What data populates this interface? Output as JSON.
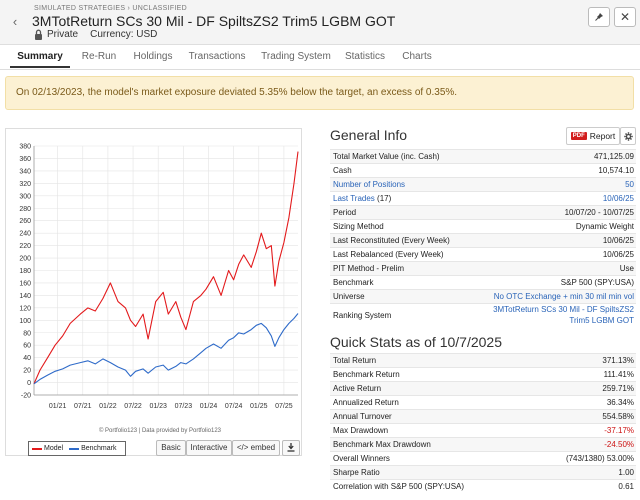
{
  "header": {
    "breadcrumb": "SIMULATED STRATEGIES › UNCLASSIFIED",
    "title": "3MTotReturn SCs 30 Mil - DF SpiltsZS2 Trim5 LGBM GOT",
    "privacy": "Private",
    "currency_label": "Currency: USD",
    "icons": {
      "back": "chevron-left-icon",
      "lock": "lock-icon",
      "pin": "pin-icon",
      "close": "close-icon"
    }
  },
  "tabs": [
    {
      "label": "Summary",
      "active": true
    },
    {
      "label": "Re-Run",
      "active": false
    },
    {
      "label": "Holdings",
      "active": false
    },
    {
      "label": "Transactions",
      "active": false
    },
    {
      "label": "Trading System",
      "active": false
    },
    {
      "label": "Statistics",
      "active": false
    },
    {
      "label": "Charts",
      "active": false
    }
  ],
  "alert": {
    "text": "On 02/13/2023, the model's market exposure deviated 5.35% below the target, an excess of 0.35%."
  },
  "chart": {
    "credit": "© Portfolio123 | Data provided by Portfolio123",
    "legend": {
      "model": "Model",
      "benchmark": "Benchmark"
    },
    "buttons": {
      "basic": "Basic",
      "interactive": "Interactive",
      "embed": "</> embed"
    },
    "colors": {
      "model": "#e31a1c",
      "benchmark": "#2f6bc9"
    }
  },
  "chart_data": {
    "type": "line",
    "title": "",
    "xlabel": "",
    "ylabel": "",
    "ylim": [
      -20,
      380
    ],
    "yticks": [
      -20,
      0,
      20,
      40,
      60,
      80,
      100,
      120,
      140,
      160,
      180,
      200,
      220,
      240,
      260,
      280,
      300,
      320,
      340,
      360,
      380
    ],
    "xlim": [
      2020.53,
      2025.78
    ],
    "x_tick_labels": [
      "01/21",
      "07/21",
      "01/22",
      "07/22",
      "01/23",
      "07/23",
      "01/24",
      "07/24",
      "01/25",
      "07/25"
    ],
    "x_tick_positions": [
      2021.0,
      2021.5,
      2022.0,
      2022.5,
      2023.0,
      2023.5,
      2024.0,
      2024.5,
      2025.0,
      2025.5
    ],
    "grid": true,
    "legend_position": "bottom-left",
    "series": [
      {
        "name": "Model",
        "x": [
          2020.53,
          2020.65,
          2020.8,
          2020.95,
          2021.1,
          2021.25,
          2021.45,
          2021.6,
          2021.75,
          2021.9,
          2022.05,
          2022.2,
          2022.35,
          2022.45,
          2022.55,
          2022.7,
          2022.8,
          2022.95,
          2023.1,
          2023.2,
          2023.35,
          2023.45,
          2023.55,
          2023.7,
          2023.85,
          2023.95,
          2024.1,
          2024.25,
          2024.4,
          2024.5,
          2024.6,
          2024.7,
          2024.85,
          2024.95,
          2025.05,
          2025.15,
          2025.25,
          2025.32,
          2025.4,
          2025.5,
          2025.6,
          2025.7,
          2025.78
        ],
        "y": [
          -2,
          20,
          40,
          60,
          75,
          95,
          110,
          120,
          115,
          135,
          160,
          130,
          120,
          100,
          90,
          110,
          70,
          130,
          145,
          110,
          130,
          105,
          85,
          130,
          140,
          150,
          170,
          140,
          180,
          165,
          190,
          205,
          185,
          210,
          240,
          215,
          220,
          155,
          195,
          225,
          265,
          320,
          371
        ]
      },
      {
        "name": "Benchmark",
        "x": [
          2020.53,
          2020.65,
          2020.8,
          2020.95,
          2021.1,
          2021.25,
          2021.45,
          2021.6,
          2021.75,
          2021.9,
          2022.05,
          2022.2,
          2022.35,
          2022.45,
          2022.55,
          2022.7,
          2022.8,
          2022.95,
          2023.1,
          2023.2,
          2023.35,
          2023.45,
          2023.55,
          2023.7,
          2023.85,
          2023.95,
          2024.1,
          2024.25,
          2024.4,
          2024.5,
          2024.6,
          2024.7,
          2024.85,
          2024.95,
          2025.05,
          2025.15,
          2025.25,
          2025.32,
          2025.4,
          2025.5,
          2025.6,
          2025.7,
          2025.78
        ],
        "y": [
          -2,
          5,
          12,
          18,
          22,
          28,
          32,
          35,
          30,
          38,
          32,
          25,
          20,
          10,
          18,
          22,
          15,
          25,
          28,
          20,
          26,
          32,
          30,
          38,
          48,
          55,
          62,
          55,
          68,
          72,
          80,
          78,
          85,
          92,
          95,
          88,
          75,
          58,
          72,
          85,
          95,
          103,
          111
        ]
      }
    ]
  },
  "general_info": {
    "title": "General Info",
    "report_label": "Report",
    "pdf_label": "PDF",
    "rows": [
      {
        "label": "Total Market Value (inc. Cash)",
        "value": "471,125.09"
      },
      {
        "label": "Cash",
        "value": "10,574.10"
      },
      {
        "label": "Number of Positions",
        "value": "50",
        "link": true
      },
      {
        "label": "Last Trades",
        "count": "(17)",
        "value": "10/06/25",
        "link": true
      },
      {
        "label": "Period",
        "value": "10/07/20 - 10/07/25"
      },
      {
        "label": "Sizing Method",
        "value": "Dynamic Weight"
      },
      {
        "label": "Last Reconstituted (Every Week)",
        "value": "10/06/25"
      },
      {
        "label": "Last Rebalanced (Every Week)",
        "value": "10/06/25"
      },
      {
        "label": "PIT Method - Prelim",
        "value": "Use"
      },
      {
        "label": "Benchmark",
        "value": "S&P 500 (SPY:USA)"
      },
      {
        "label": "Universe",
        "value": "No OTC Exchange + min 30 mil min vol",
        "value_link": true
      },
      {
        "label": "Ranking System",
        "value": "3MTotReturn SCs 30 Mil - DF SpiltsZS2 Trim5 LGBM GOT",
        "value_link": true
      }
    ]
  },
  "quick_stats": {
    "title": "Quick Stats as of 10/7/2025",
    "rows": [
      {
        "label": "Total Return",
        "value": "371.13%"
      },
      {
        "label": "Benchmark Return",
        "value": "111.41%"
      },
      {
        "label": "Active Return",
        "value": "259.71%"
      },
      {
        "label": "Annualized Return",
        "value": "36.34%"
      },
      {
        "label": "Annual Turnover",
        "value": "554.58%"
      },
      {
        "label": "Max Drawdown",
        "value": "-37.17%",
        "negative": true
      },
      {
        "label": "Benchmark Max Drawdown",
        "value": "-24.50%",
        "negative": true
      },
      {
        "label": "Overall Winners",
        "value": "(743/1380) 53.00%"
      },
      {
        "label": "Sharpe Ratio",
        "value": "1.00"
      },
      {
        "label": "Correlation with S&P 500 (SPY:USA)",
        "value": "0.61"
      }
    ]
  }
}
